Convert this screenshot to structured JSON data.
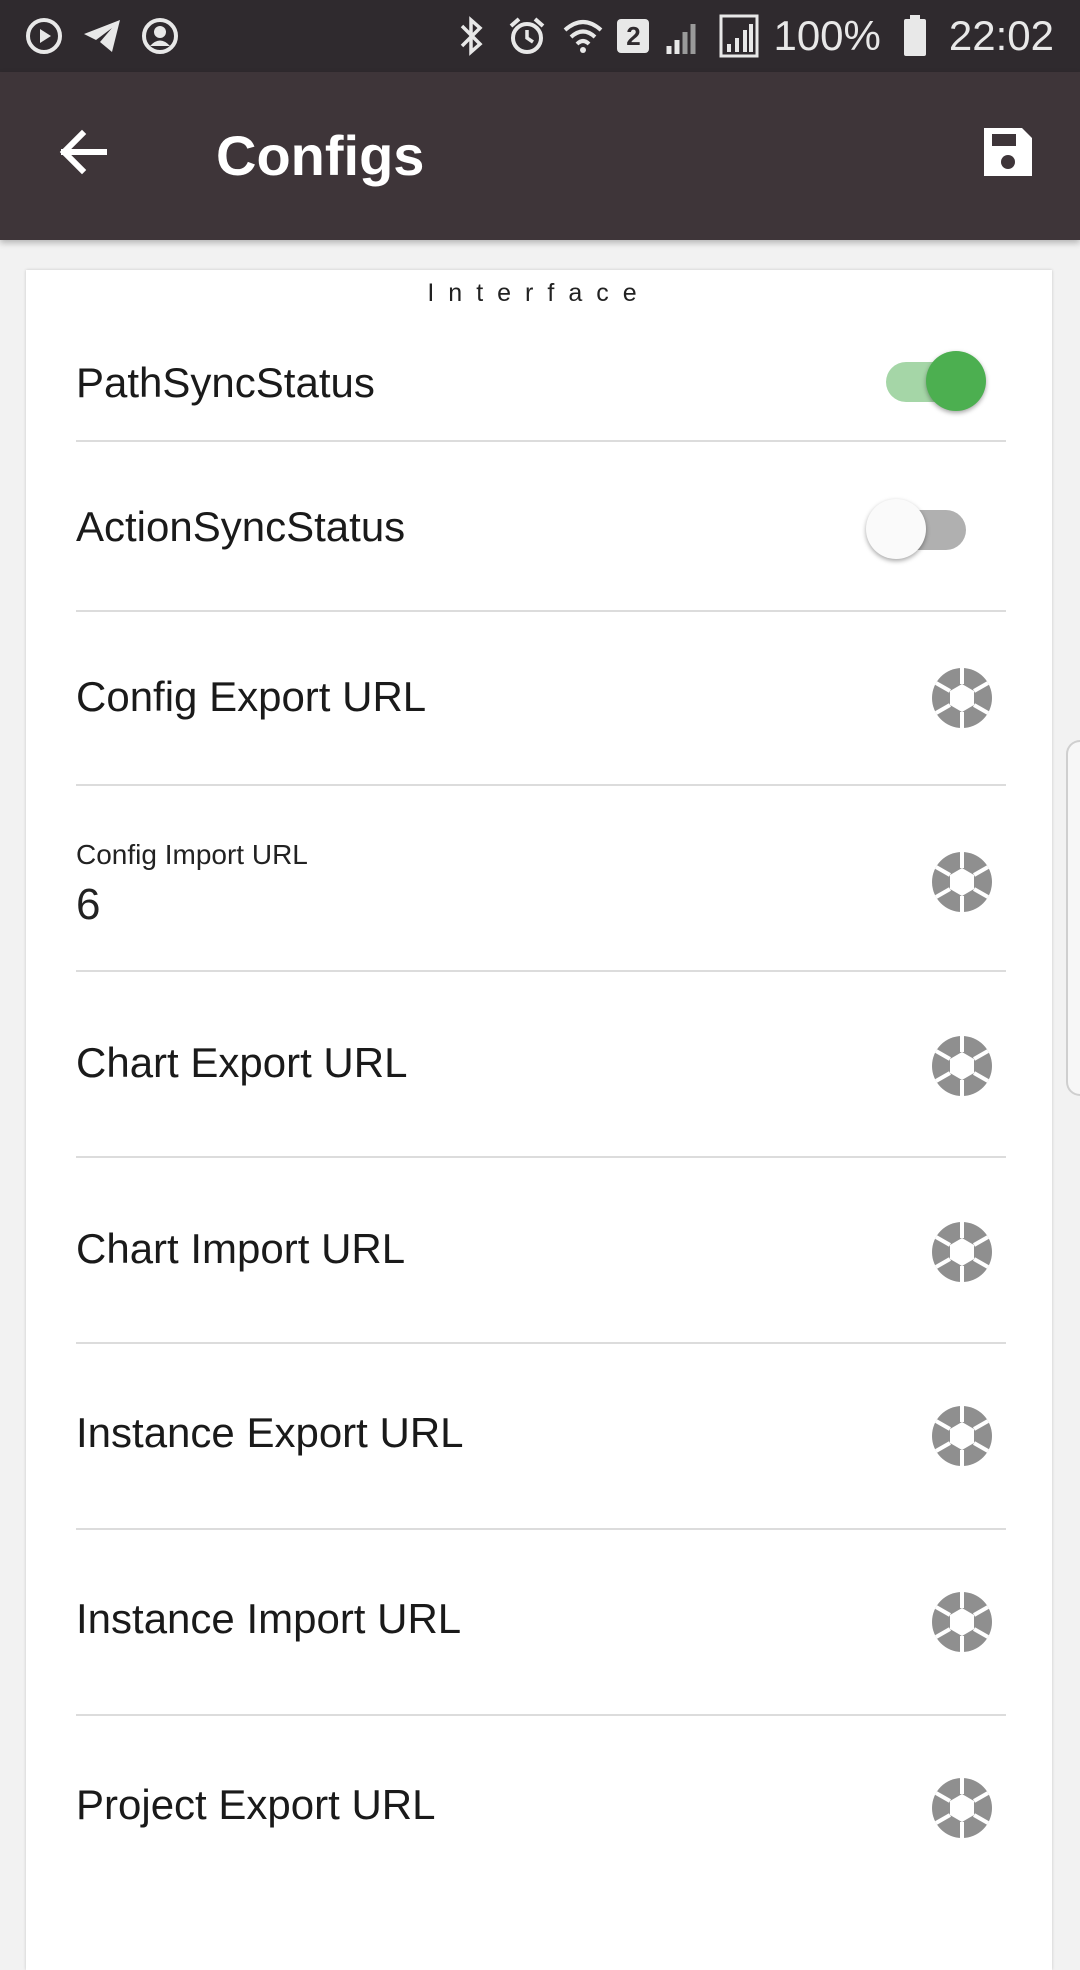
{
  "status_bar": {
    "battery_percent": "100%",
    "time": "22:02",
    "wifi_badge": "2",
    "left_icons": [
      "media-icon",
      "telegram-icon",
      "account-circle-icon"
    ],
    "right_icons": [
      "bluetooth-icon",
      "alarm-icon",
      "wifi-icon",
      "signal-icon",
      "signal-icon",
      "battery-icon"
    ]
  },
  "app_bar": {
    "title": "Configs",
    "back_icon": "arrow-left-icon",
    "save_icon": "save-icon",
    "background": "#3e3539"
  },
  "section": {
    "title": "Interface"
  },
  "settings": {
    "path_sync": {
      "label": "PathSyncStatus",
      "enabled": true
    },
    "action_sync": {
      "label": "ActionSyncStatus",
      "enabled": false
    },
    "config_export": {
      "label": "Config Export URL"
    },
    "config_import": {
      "label": "Config Import URL",
      "value": "6"
    },
    "chart_export": {
      "label": "Chart Export URL"
    },
    "chart_import": {
      "label": "Chart Import URL"
    },
    "instance_export": {
      "label": "Instance Export URL"
    },
    "instance_import": {
      "label": "Instance Import URL"
    },
    "project_export": {
      "label": "Project Export URL"
    }
  },
  "colors": {
    "toggle_on": "#4caf50",
    "toggle_on_track": "#a5d6a7",
    "toggle_off_thumb": "#fafafa",
    "toggle_off_track": "#b0b0b0",
    "aperture_icon": "#8f8f8f"
  }
}
